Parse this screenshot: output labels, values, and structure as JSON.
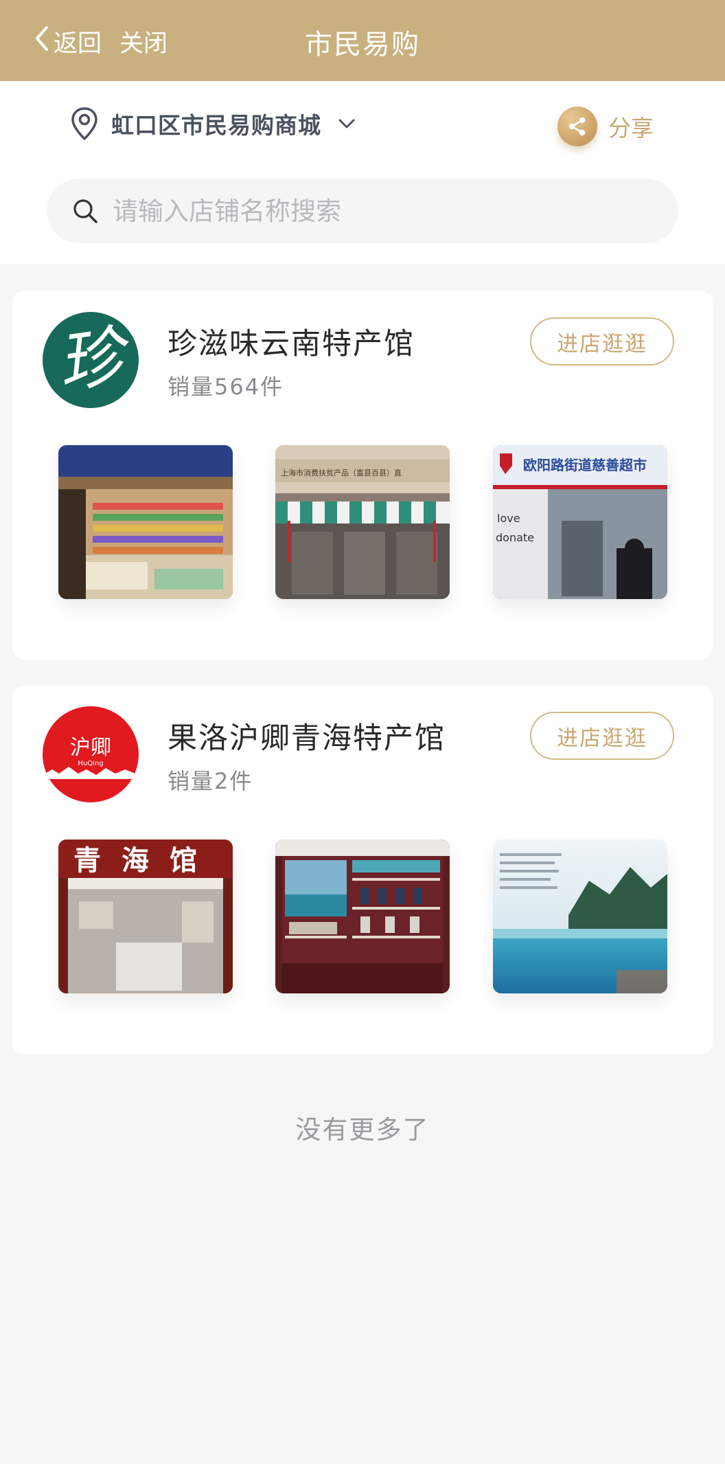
{
  "navbar": {
    "back_label": "返回",
    "close_label": "关闭",
    "title": "市民易购",
    "background_color": "#c8b17f"
  },
  "header": {
    "location_icon": "location-pin-icon",
    "location_name": "虹口区市民易购商城",
    "location_dropdown_icon": "chevron-down-icon",
    "share_icon": "share-icon",
    "share_label": "分享"
  },
  "search": {
    "icon": "search-icon",
    "placeholder": "请输入店铺名称搜索",
    "value": ""
  },
  "stores": [
    {
      "logo": "store-logo-zhen",
      "logo_text": "珍",
      "name": "珍滋味云南特产馆",
      "sales": "销量564件",
      "enter_label": "进店逛逛",
      "photos": [
        "storefront-shelves-photo",
        "storefront-awning-photo",
        "storefront-charity-supermarket-photo"
      ],
      "photo_text": {
        "sign2": "上海市消费扶贫产品（富县百县）直",
        "sign3": "欧阳路街道慈善超市",
        "poster_words": [
          "love",
          "donate"
        ]
      }
    },
    {
      "logo": "store-logo-huqing",
      "logo_text": "沪卿",
      "logo_subtext": "HuQing",
      "name": "果洛沪卿青海特产馆",
      "sales": "销量2件",
      "enter_label": "进店逛逛",
      "photos": [
        "qinghai-hall-entrance-photo",
        "display-cabinet-photo",
        "lake-scenery-photo"
      ],
      "photo_text": {
        "sign1": "青海馆"
      }
    }
  ],
  "footer": {
    "no_more_text": "没有更多了"
  },
  "colors": {
    "accent_gold": "#c8a773",
    "page_background": "#f6f6f7"
  }
}
